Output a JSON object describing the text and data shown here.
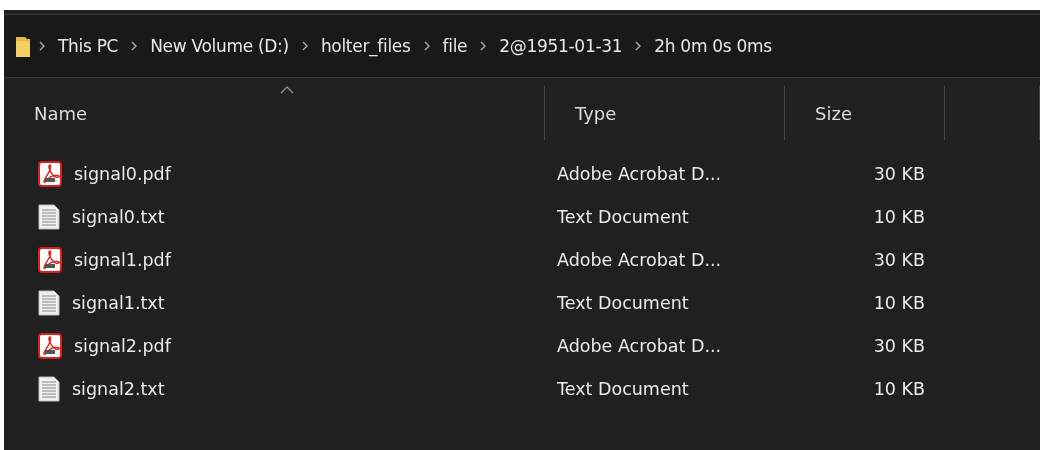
{
  "breadcrumb": [
    "This PC",
    "New Volume (D:)",
    "holter_files",
    "file",
    "2@1951-01-31",
    "2h 0m 0s 0ms"
  ],
  "columns": [
    {
      "label": "Name",
      "sorted": true
    },
    {
      "label": "Type",
      "sorted": false
    },
    {
      "label": "Size",
      "sorted": false
    }
  ],
  "files": [
    {
      "name": "signal0.pdf",
      "type": "Adobe Acrobat D...",
      "size": "30 KB",
      "kind": "pdf"
    },
    {
      "name": "signal0.txt",
      "type": "Text Document",
      "size": "10 KB",
      "kind": "txt"
    },
    {
      "name": "signal1.pdf",
      "type": "Adobe Acrobat D...",
      "size": "30 KB",
      "kind": "pdf"
    },
    {
      "name": "signal1.txt",
      "type": "Text Document",
      "size": "10 KB",
      "kind": "txt"
    },
    {
      "name": "signal2.pdf",
      "type": "Adobe Acrobat D...",
      "size": "30 KB",
      "kind": "pdf"
    },
    {
      "name": "signal2.txt",
      "type": "Text Document",
      "size": "10 KB",
      "kind": "txt"
    }
  ]
}
